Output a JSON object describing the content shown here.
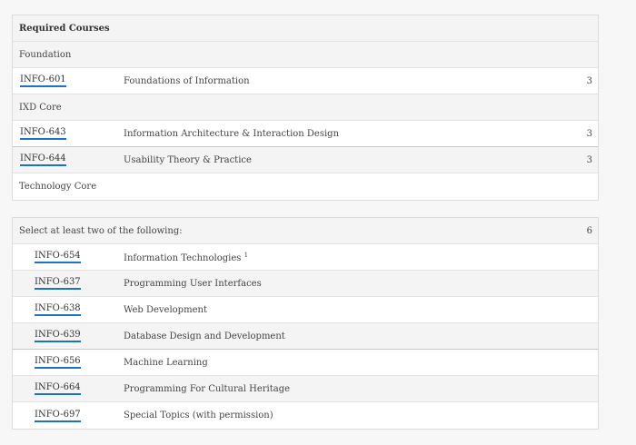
{
  "required": {
    "header": "Required Courses",
    "foundation": {
      "label": "Foundation",
      "courses": [
        {
          "code": "INFO-601",
          "title": "Foundations of Information",
          "credits": "3"
        }
      ]
    },
    "ixd_core": {
      "label": "IXD Core",
      "courses": [
        {
          "code": "INFO-643",
          "title": "Information Architecture & Interaction Design",
          "credits": "3"
        },
        {
          "code": "INFO-644",
          "title": "Usability Theory & Practice",
          "credits": "3"
        }
      ]
    },
    "technology_core": {
      "label": "Technology Core"
    }
  },
  "electives": {
    "label": "Select at least two of the following:",
    "credits": "6",
    "courses": [
      {
        "code": "INFO-654",
        "title": "Information Technologies",
        "footnote": "1"
      },
      {
        "code": "INFO-637",
        "title": "Programming User Interfaces"
      },
      {
        "code": "INFO-638",
        "title": "Web Development"
      },
      {
        "code": "INFO-639",
        "title": "Database Design and Development"
      },
      {
        "code": "INFO-656",
        "title": "Machine Learning"
      },
      {
        "code": "INFO-664",
        "title": "Programming For Cultural Heritage"
      },
      {
        "code": "INFO-697",
        "title": "Special Topics (with permission)"
      }
    ]
  },
  "colors": {
    "link_underline": "#1e73be",
    "row_shade": "#f4f4f4",
    "border": "#dcdcdc"
  }
}
